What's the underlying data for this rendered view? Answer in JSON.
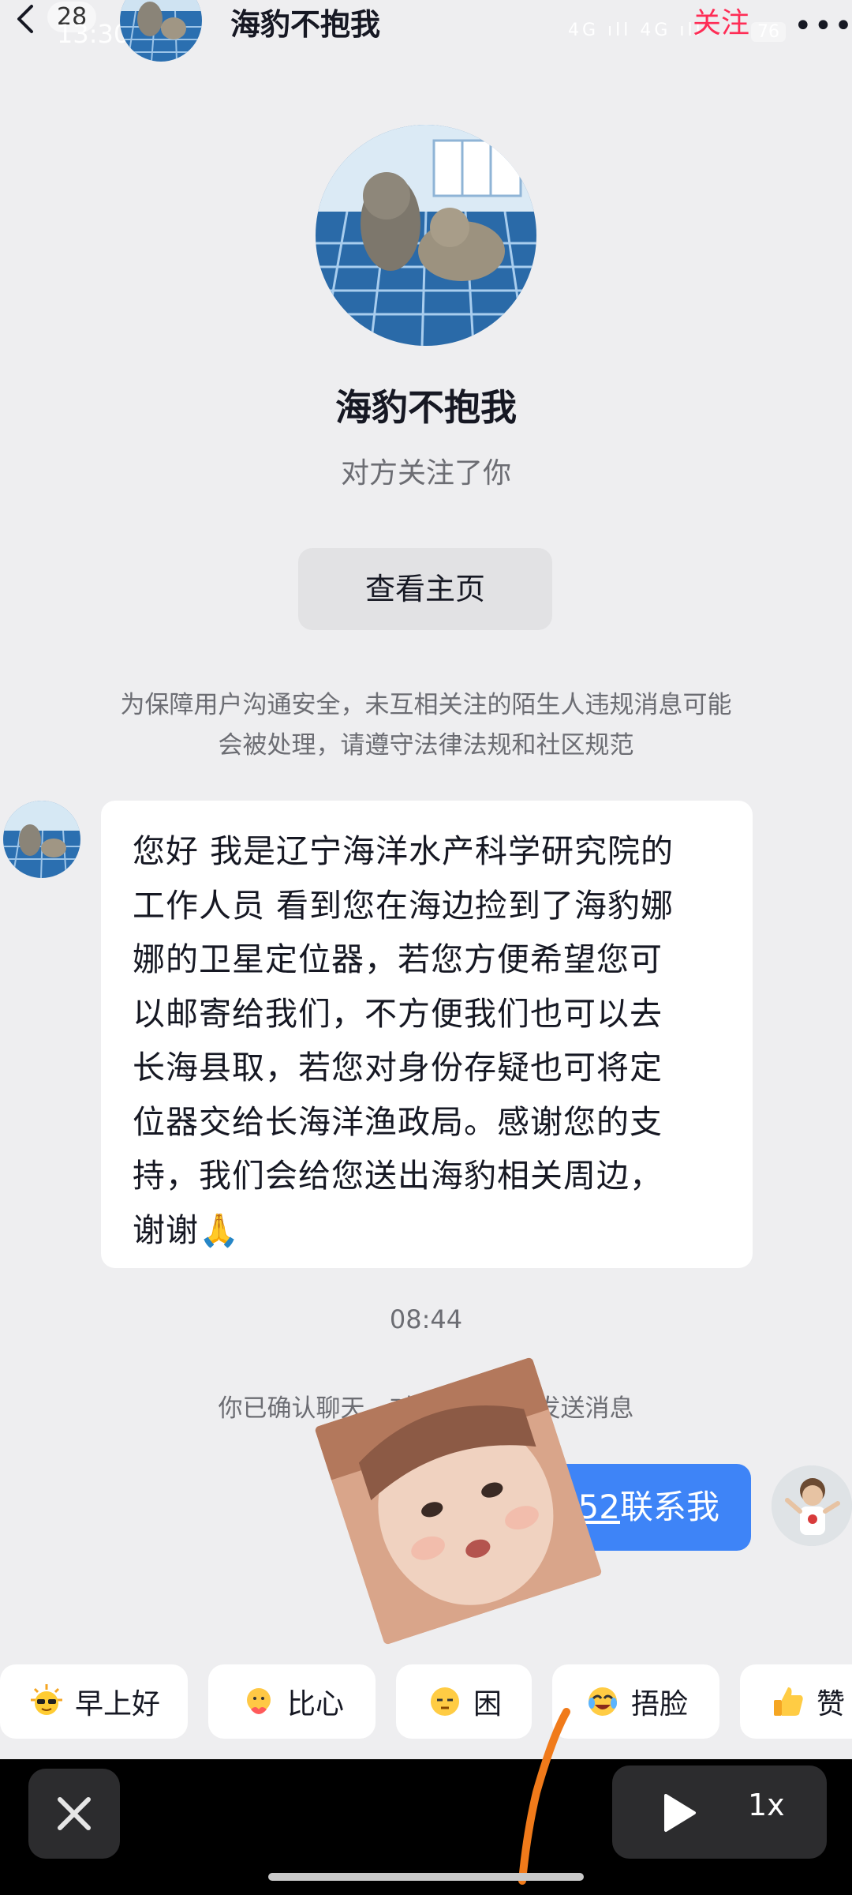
{
  "status_bar": {
    "time": "13:30",
    "network": "4G ıll 4G ıll",
    "battery": "76"
  },
  "header": {
    "unread_count": "28",
    "contact_name": "海豹不抱我",
    "follow_label": "关注",
    "more_icon": "more-icon"
  },
  "profile": {
    "name": "海豹不抱我",
    "subtitle": "对方关注了你",
    "view_home_label": "查看主页"
  },
  "notice": {
    "line1": "为保障用户沟通安全，未互相关注的陌生人违规消息可能",
    "line2": "会被处理，请遵守法律法规和社区规范"
  },
  "messages": {
    "received": {
      "lines": [
        "您好 我是辽宁海洋水产科学研究院的",
        "工作人员  看到您在海边捡到了海豹娜",
        "娜的卫星定位器，若您方便希望您可",
        "以邮寄给我们，不方便我们也可以去",
        "长海县取，若您对身份存疑也可将定",
        "位器交给长海洋渔政局。感谢您的支",
        "持，我们会给您送出海豹相关周边，",
        "谢谢🙏"
      ]
    },
    "time": "08:44",
    "confirm_note": "你已确认聊天，对方可以向你发送消息",
    "sent": {
      "number_fragment": "552",
      "text": "联系我"
    }
  },
  "quick_replies": [
    {
      "label": "早上好",
      "icon": "sun-sunglasses-emoji"
    },
    {
      "label": "比心",
      "icon": "heart-hands-emoji"
    },
    {
      "label": "困",
      "icon": "sleepy-emoji"
    },
    {
      "label": "捂脸",
      "icon": "facepalm-laugh-emoji"
    },
    {
      "label": "赞",
      "icon": "thumbs-up-emoji"
    }
  ],
  "player": {
    "speed_label": "1x"
  },
  "colors": {
    "accent_red": "#fe2c55",
    "sent_bubble": "#3e84f7",
    "background": "#eeeef0"
  }
}
